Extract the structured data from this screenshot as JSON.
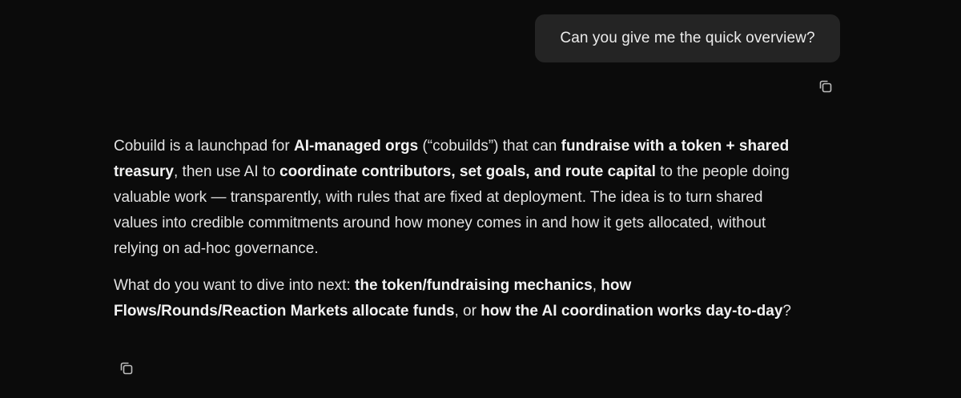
{
  "user_message": {
    "text": "Can you give me the quick overview?"
  },
  "assistant_message": {
    "p1": {
      "t1": "Cobuild is a launchpad for ",
      "b1": "AI-managed orgs",
      "t2": " (“cobuilds”) that can ",
      "b2": "fundraise with a token + shared treasury",
      "t3": ", then use AI to ",
      "b3": "coordinate contributors, set goals, and route capital",
      "t4": " to the people doing valuable work — transparently, with rules that are fixed at deployment. The idea is to turn shared values into credible commitments around how money comes in and how it gets allocated, without relying on ad-hoc governance."
    },
    "p2": {
      "t1": "What do you want to dive into next: ",
      "b1": "the token/fundraising mechanics",
      "t2": ", ",
      "b2": "how Flows/Rounds/Reaction Markets allocate funds",
      "t3": ", or ",
      "b3": "how the AI coordination works day-to-day",
      "t4": "?"
    }
  },
  "icons": {
    "copy": "copy-icon"
  },
  "colors": {
    "background": "#0b0b0b",
    "bubble": "#242424",
    "text": "#e2e2e2",
    "icon": "#bdbdbd"
  }
}
